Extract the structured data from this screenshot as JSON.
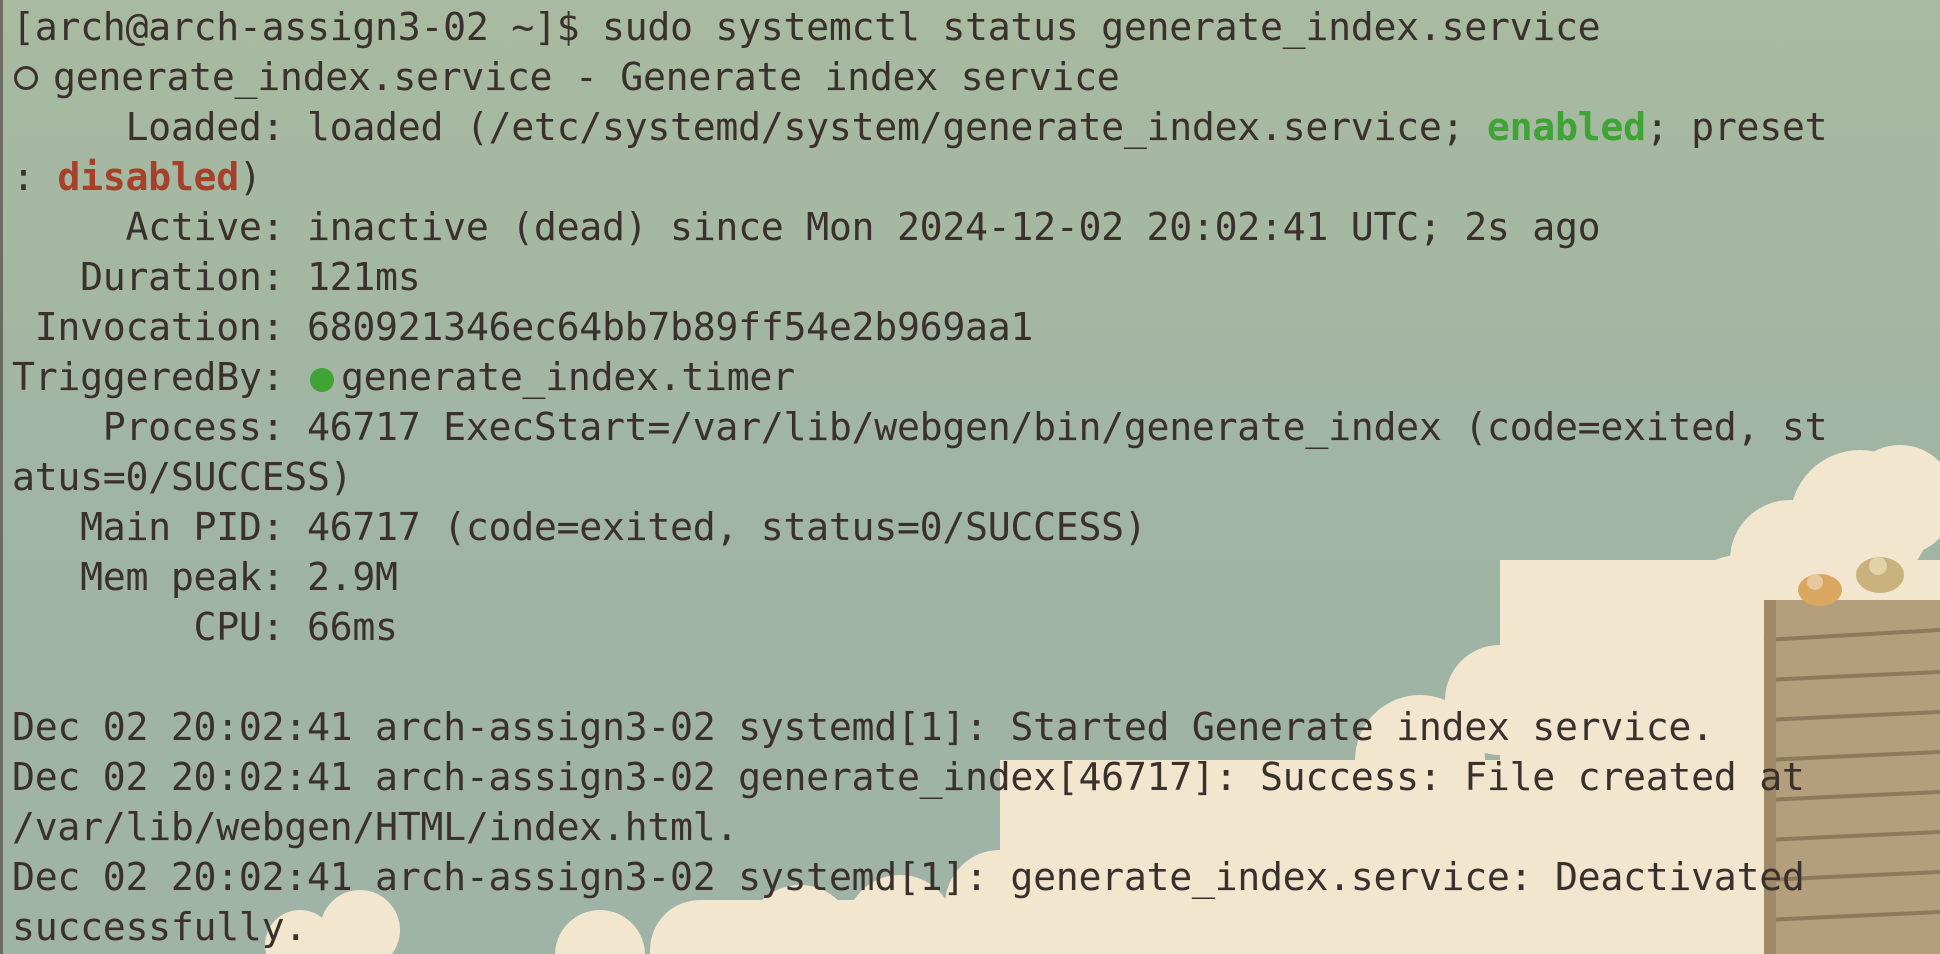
{
  "terminal": {
    "prompt": "[arch@arch-assign3-02 ~]$ sudo systemctl status generate_index.service",
    "unit_header": "generate_index.service - Generate index service",
    "loaded": {
      "label": "     Loaded: ",
      "text_a": "loaded (/etc/systemd/system/generate_index.service; ",
      "enabled": "enabled",
      "text_b": "; preset",
      "wrap_prefix": ": ",
      "disabled": "disabled",
      "wrap_suffix": ")"
    },
    "active": "     Active: inactive (dead) since Mon 2024-12-02 20:02:41 UTC; 2s ago",
    "duration": "   Duration: 121ms",
    "invocation": " Invocation: 680921346ec64bb7b89ff54e2b969aa1",
    "triggered": {
      "label": "TriggeredBy: ",
      "unit": "generate_index.timer"
    },
    "process_1": "    Process: 46717 ExecStart=/var/lib/webgen/bin/generate_index (code=exited, st",
    "process_2": "atus=0/SUCCESS)",
    "main_pid": "   Main PID: 46717 (code=exited, status=0/SUCCESS)",
    "mem_peak": "   Mem peak: 2.9M",
    "cpu": "        CPU: 66ms",
    "log": [
      "Dec 02 20:02:41 arch-assign3-02 systemd[1]: Started Generate index service.",
      "Dec 02 20:02:41 arch-assign3-02 generate_index[46717]: Success: File created at",
      "/var/lib/webgen/HTML/index.html.",
      "Dec 02 20:02:41 arch-assign3-02 systemd[1]: generate_index.service: Deactivated",
      "successfully."
    ]
  },
  "colors": {
    "background": "#a2b7a3",
    "text": "#3a302c",
    "enabled": "#3fa336",
    "disabled": "#a5402b",
    "active_dot": "#3fa336"
  },
  "icons": {
    "unit_state": "hollow-circle-icon",
    "timer_state": "green-dot-icon"
  }
}
